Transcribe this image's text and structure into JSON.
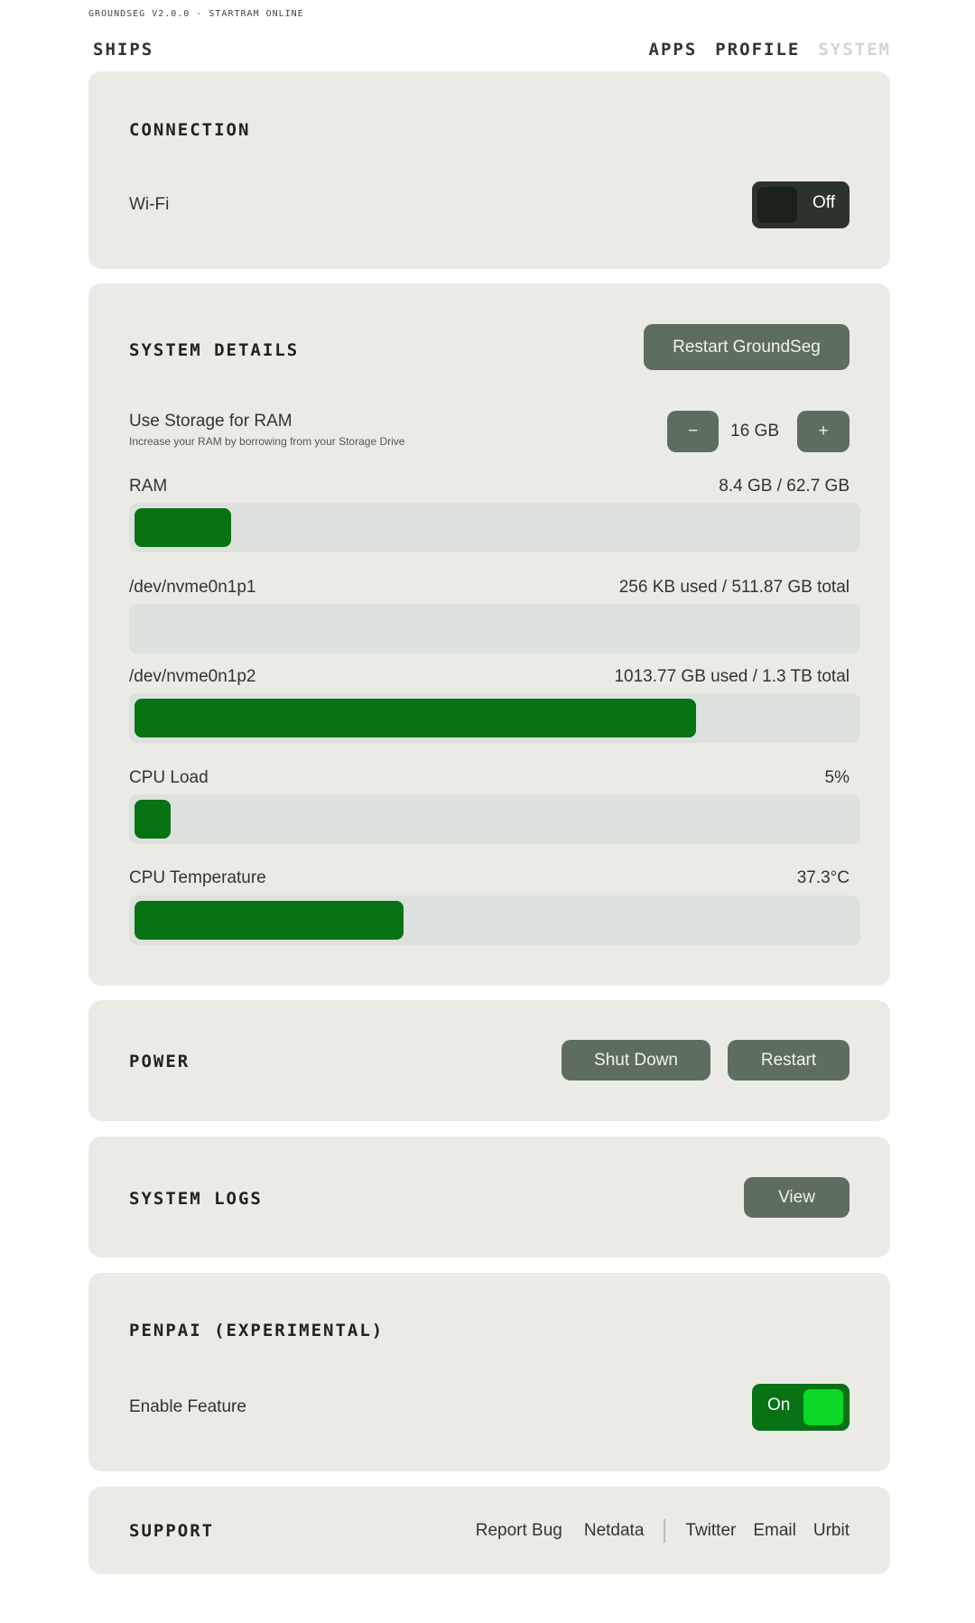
{
  "header": {
    "version_line": "GROUNDSEG V2.0.0 - STARTRAM ONLINE",
    "nav_left": "SHIPS",
    "nav_items": [
      "APPS",
      "PROFILE",
      "SYSTEM"
    ]
  },
  "connection": {
    "title": "CONNECTION",
    "wifi_label": "Wi-Fi",
    "wifi_toggle": "Off",
    "wifi_enabled": false
  },
  "system_details": {
    "title": "SYSTEM DETAILS",
    "restart_label": "Restart GroundSeg",
    "swap": {
      "label": "Use Storage for RAM",
      "description": "Increase your RAM by borrowing from your Storage Drive",
      "value": "16 GB",
      "minus": "−",
      "plus": "+"
    },
    "ram": {
      "label": "RAM",
      "value": "8.4 GB / 62.7 GB",
      "fraction": 0.134
    },
    "disks": [
      {
        "label": "/dev/nvme0n1p1",
        "value": "256 KB used / 511.87 GB total",
        "fraction": 0.0
      },
      {
        "label": "/dev/nvme0n1p2",
        "value": "1013.77 GB used / 1.3 TB total",
        "fraction": 0.78
      }
    ],
    "cpu_load": {
      "label": "CPU Load",
      "value": "5%",
      "fraction": 0.05
    },
    "cpu_temp": {
      "label": "CPU Temperature",
      "value": "37.3°C",
      "fraction": 0.373
    }
  },
  "power": {
    "title": "POWER",
    "shutdown_label": "Shut Down",
    "restart_label": "Restart"
  },
  "system_logs": {
    "title": "SYSTEM LOGS",
    "view_label": "View"
  },
  "penpai": {
    "title": "PENPAI (EXPERIMENTAL)",
    "feature_label": "Enable Feature",
    "toggle": "On",
    "enabled": true
  },
  "support": {
    "title": "SUPPORT",
    "links": [
      "Report Bug",
      "Netdata",
      "Twitter",
      "Email",
      "Urbit"
    ]
  },
  "colors": {
    "card_bg": "#ebebe6",
    "button_bg": "#5d6e5e",
    "bar_fill": "#067214",
    "bar_track": "#dde1de",
    "toggle_off_bg": "#2c332c",
    "toggle_on_bg": "#067214",
    "toggle_on_knob": "#0ad824"
  }
}
